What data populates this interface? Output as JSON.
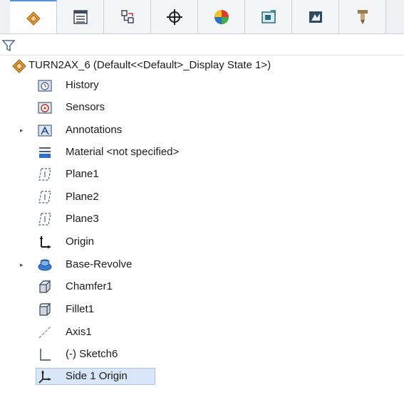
{
  "tabs": [
    {
      "icon": "feature-manager-icon",
      "active": true
    },
    {
      "icon": "property-manager-icon",
      "active": false
    },
    {
      "icon": "configuration-manager-icon",
      "active": false
    },
    {
      "icon": "dimxpert-manager-icon",
      "active": false
    },
    {
      "icon": "display-manager-icon",
      "active": false
    },
    {
      "icon": "cam-feature-tree-icon",
      "active": false
    },
    {
      "icon": "cam-operation-tree-icon",
      "active": false
    },
    {
      "icon": "cam-tool-tree-icon",
      "active": false
    }
  ],
  "filter": {
    "icon": "filter-icon"
  },
  "tree": {
    "root": {
      "label": "TURN2AX_6  (Default<<Default>_Display State 1>)",
      "icon": "part-icon"
    },
    "items": [
      {
        "label": "History",
        "icon": "history-folder-icon",
        "expandable": false
      },
      {
        "label": "Sensors",
        "icon": "sensors-folder-icon",
        "expandable": false
      },
      {
        "label": "Annotations",
        "icon": "annotations-folder-icon",
        "expandable": true
      },
      {
        "label": "Material <not specified>",
        "icon": "material-icon",
        "expandable": false
      },
      {
        "label": "Plane1",
        "icon": "plane-icon",
        "expandable": false
      },
      {
        "label": "Plane2",
        "icon": "plane-icon",
        "expandable": false
      },
      {
        "label": "Plane3",
        "icon": "plane-icon",
        "expandable": false
      },
      {
        "label": "Origin",
        "icon": "origin-icon",
        "expandable": false
      },
      {
        "label": "Base-Revolve",
        "icon": "revolve-icon",
        "expandable": true
      },
      {
        "label": "Chamfer1",
        "icon": "chamfer-icon",
        "expandable": false
      },
      {
        "label": "Fillet1",
        "icon": "fillet-icon",
        "expandable": false
      },
      {
        "label": "Axis1",
        "icon": "axis-icon",
        "expandable": false
      },
      {
        "label": "(-) Sketch6",
        "icon": "sketch-icon",
        "expandable": false
      },
      {
        "label": "Side 1 Origin",
        "icon": "coordinate-system-icon",
        "expandable": false,
        "selected": true
      }
    ]
  }
}
